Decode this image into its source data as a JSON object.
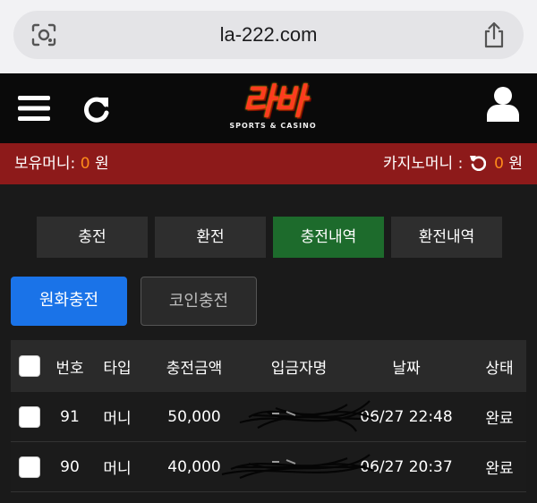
{
  "browser": {
    "url": "la-222.com"
  },
  "header": {
    "logo_text": "라바",
    "logo_sub": "SPORTS & CASINO"
  },
  "balance": {
    "left_label": "보유머니:",
    "left_value": "0",
    "left_unit": "원",
    "right_label": "카지노머니 :",
    "right_value": "0",
    "right_unit": "원"
  },
  "tabs": [
    {
      "label": "충전",
      "active": false
    },
    {
      "label": "환전",
      "active": false
    },
    {
      "label": "충전내역",
      "active": true
    },
    {
      "label": "환전내역",
      "active": false
    }
  ],
  "subtabs": [
    {
      "label": "원화충전",
      "active": true
    },
    {
      "label": "코인충전",
      "active": false
    }
  ],
  "table": {
    "headers": [
      "번호",
      "타입",
      "충전금액",
      "입금자명",
      "날짜",
      "상태"
    ],
    "rows": [
      {
        "no": "91",
        "type": "머니",
        "amount": "50,000",
        "depositor": "",
        "date": "06/27 22:48",
        "status": "완료"
      },
      {
        "no": "90",
        "type": "머니",
        "amount": "40,000",
        "depositor": "",
        "date": "06/27 20:37",
        "status": "완료"
      }
    ]
  },
  "colors": {
    "balance_bar": "#8d1a1a",
    "active_tab": "#1d6b2c",
    "active_subtab": "#1a73e8",
    "balance_value": "#ff8c1a"
  }
}
